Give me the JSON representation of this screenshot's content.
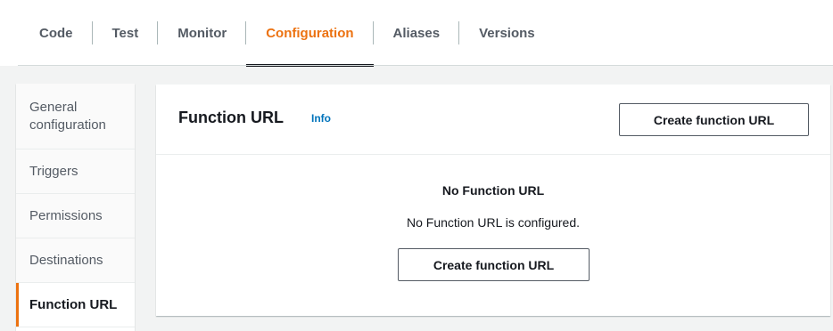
{
  "tabs": [
    {
      "label": "Code"
    },
    {
      "label": "Test"
    },
    {
      "label": "Monitor"
    },
    {
      "label": "Configuration"
    },
    {
      "label": "Aliases"
    },
    {
      "label": "Versions"
    }
  ],
  "active_tab": "Configuration",
  "sidenav": {
    "items": [
      {
        "label": "General configuration"
      },
      {
        "label": "Triggers"
      },
      {
        "label": "Permissions"
      },
      {
        "label": "Destinations"
      },
      {
        "label": "Function URL"
      }
    ],
    "active": "Function URL"
  },
  "panel": {
    "title": "Function URL",
    "info_label": "Info",
    "header_button_label": "Create function URL",
    "empty_title": "No Function URL",
    "empty_description": "No Function URL is configured.",
    "center_button_label": "Create function URL"
  },
  "colors": {
    "accent": "#ec7211",
    "link": "#0073bb",
    "text": "#16191f",
    "muted": "#545b64",
    "background": "#f2f3f3"
  }
}
